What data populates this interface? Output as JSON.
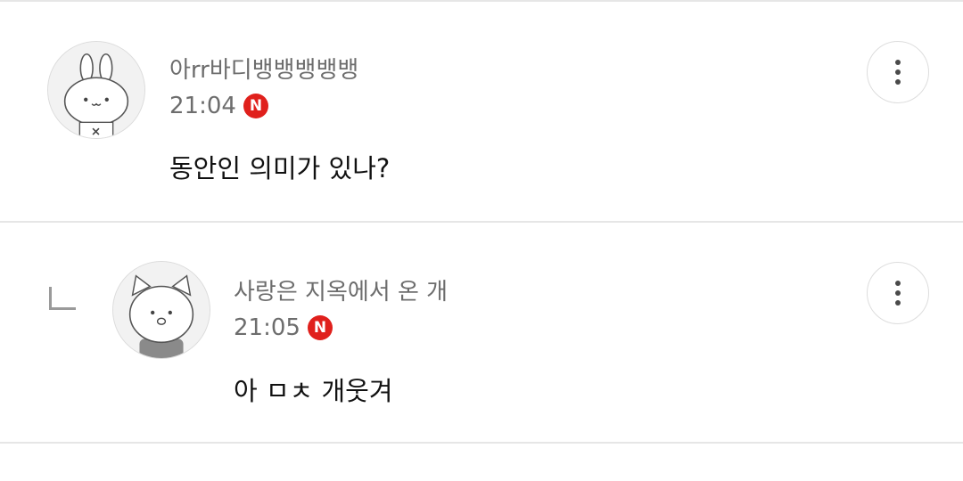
{
  "comments": [
    {
      "username": "아rr바디뱅뱅뱅뱅뱅",
      "time": "21:04",
      "badge": "N",
      "text": "동안인 의미가 있나?",
      "avatar": "rabbit-avatar-icon",
      "is_reply": false
    },
    {
      "username": "사랑은 지옥에서 온 개",
      "time": "21:05",
      "badge": "N",
      "text": "아 ㅁㅊ 개웃겨",
      "avatar": "cat-avatar-icon",
      "is_reply": true
    }
  ],
  "colors": {
    "badge": "#e0201c",
    "meta_text": "#6d6d6d",
    "body_text": "#111111",
    "divider": "#e6e6e6"
  },
  "icons": {
    "more": "vertical-ellipsis-icon",
    "reply": "reply-corner-icon"
  }
}
